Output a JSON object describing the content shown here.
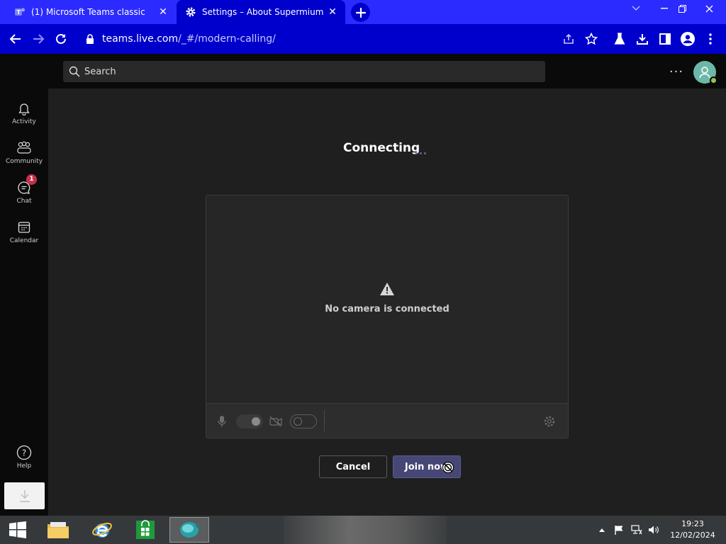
{
  "browser": {
    "tabs": [
      {
        "title": "(1) Microsoft Teams classic",
        "icon": "teams-icon"
      },
      {
        "title": "Settings – About Supermium",
        "icon": "gear-icon"
      }
    ],
    "url_host": "teams.live.com",
    "url_path": "/_#/modern-calling/"
  },
  "teams": {
    "search_placeholder": "Search",
    "rail": [
      {
        "label": "Activity",
        "icon": "bell-icon"
      },
      {
        "label": "Community",
        "icon": "community-icon"
      },
      {
        "label": "Chat",
        "icon": "chat-icon",
        "badge": "1"
      },
      {
        "label": "Calendar",
        "icon": "calendar-icon"
      },
      {
        "label": "Help",
        "icon": "help-icon"
      }
    ],
    "more_label": "···"
  },
  "prejoin": {
    "status": "Connecting",
    "no_camera_message": "No camera is connected",
    "cancel_label": "Cancel",
    "join_label": "Join now",
    "mic_on": true,
    "camera_on": false
  },
  "taskbar": {
    "time": "19:23",
    "date": "12/02/2024"
  },
  "colors": {
    "browser_accent": "#0000cc",
    "tabstrip": "#2b2bff",
    "teams_purple": "#464775",
    "badge_red": "#c4314b",
    "presence_green": "#92c353"
  }
}
